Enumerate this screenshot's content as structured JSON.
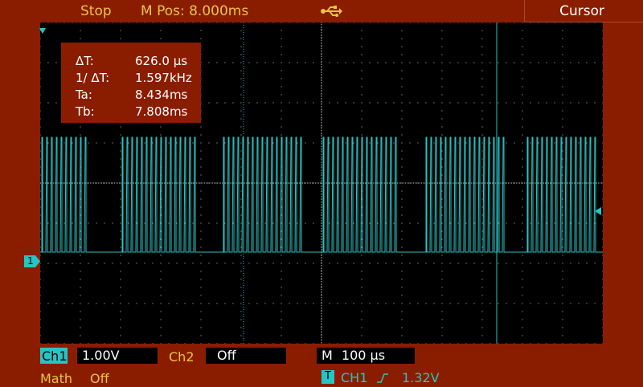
{
  "top": {
    "run_state": "Stop",
    "mpos_label": "M Pos: 8.000ms",
    "usb_icon": "usb-icon",
    "menu_title": "Cursor"
  },
  "readout": {
    "rows": [
      {
        "label": "ΔT:",
        "value": "626.0 µs"
      },
      {
        "label": "1/ ΔT:",
        "value": "1.597kHz"
      },
      {
        "label": "Ta:",
        "value": "8.434ms"
      },
      {
        "label": "Tb:",
        "value": "7.808ms"
      }
    ]
  },
  "channel_marker": "1",
  "bottom": {
    "ch1_label": "Ch1",
    "ch1_scale": "1.00V",
    "ch2_label": "Ch2",
    "ch2_state": "Off",
    "time_label": "M",
    "time_scale": "100 µs",
    "math_label": "Math",
    "math_state": "Off",
    "trigger_badge": "T",
    "trigger_source": "CH1",
    "trigger_level": "1.32V"
  },
  "colors": {
    "frame": "#8a1d00",
    "screen": "#000000",
    "trace": "#27c4c4",
    "label": "#e8c34a",
    "grid": "#c8c8c8"
  }
}
